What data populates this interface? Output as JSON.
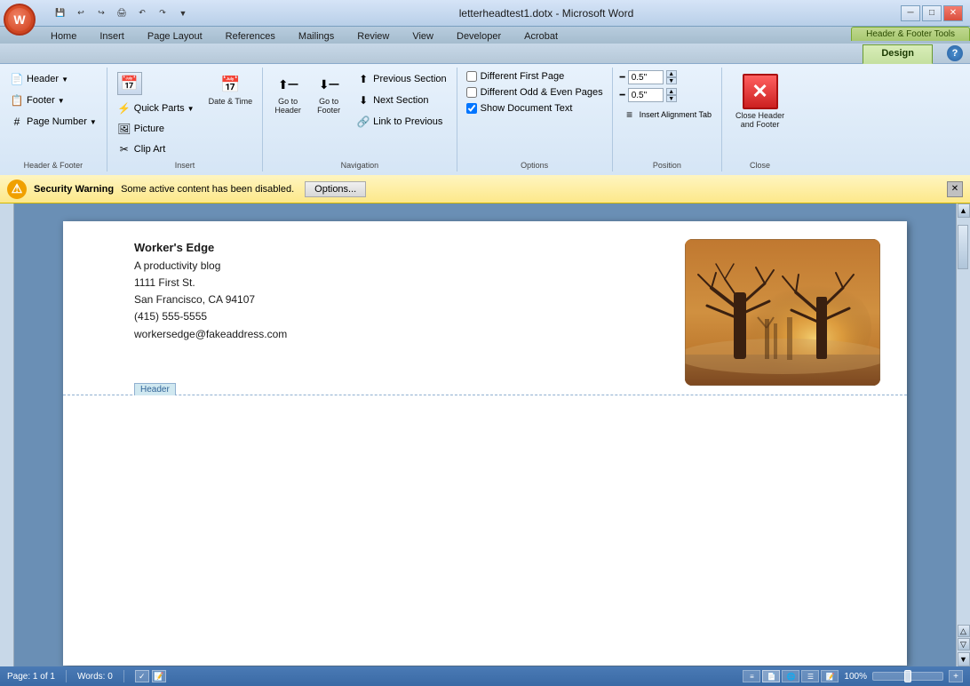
{
  "window": {
    "title": "letterheadtest1.dotx - Microsoft Word",
    "hf_tools_label": "Header & Footer Tools"
  },
  "tabs": {
    "home": "Home",
    "insert": "Insert",
    "page_layout": "Page Layout",
    "references": "References",
    "mailings": "Mailings",
    "review": "Review",
    "view": "View",
    "developer": "Developer",
    "acrobat": "Acrobat",
    "design": "Design"
  },
  "groups": {
    "header_footer": {
      "label": "Header & Footer",
      "header_btn": "Header",
      "footer_btn": "Footer",
      "page_number_btn": "Page Number"
    },
    "insert": {
      "label": "Insert",
      "date_time_btn": "Date & Time",
      "quick_parts_btn": "Quick Parts",
      "picture_btn": "Picture",
      "clip_art_btn": "Clip Art"
    },
    "navigation": {
      "label": "Navigation",
      "goto_header_btn": "Go to\nHeader",
      "goto_footer_btn": "Go to\nFooter",
      "previous_section_btn": "Previous Section",
      "next_section_btn": "Next Section",
      "link_to_prev_btn": "Link to Previous"
    },
    "options": {
      "label": "Options",
      "diff_first_page": "Different First Page",
      "diff_odd_even": "Different Odd & Even Pages",
      "show_doc_text": "Show Document Text"
    },
    "position": {
      "label": "Position",
      "header_pos_label": "Header pos",
      "footer_pos_label": "Footer pos",
      "header_pos_val": "0.5\"",
      "footer_pos_val": "0.5\""
    },
    "close": {
      "label": "Close",
      "close_btn": "Close Header\nand Footer"
    }
  },
  "security": {
    "warning_title": "Security Warning",
    "warning_text": "Some active content has been disabled.",
    "options_btn": "Options...",
    "icon": "⚠"
  },
  "document": {
    "company": "Worker's Edge",
    "tagline": "A productivity blog",
    "address1": "1111 First St.",
    "city_state": "San Francisco, CA 94107",
    "phone": "(415) 555-5555",
    "email": "workersedge@fakeaddress.com",
    "header_label": "Header"
  },
  "status_bar": {
    "page_info": "Page: 1 of 1",
    "words": "Words: 0",
    "zoom": "100%"
  },
  "quick_access": {
    "btns": [
      "💾",
      "↩",
      "↪",
      "🖨",
      "↶",
      "↷"
    ]
  }
}
